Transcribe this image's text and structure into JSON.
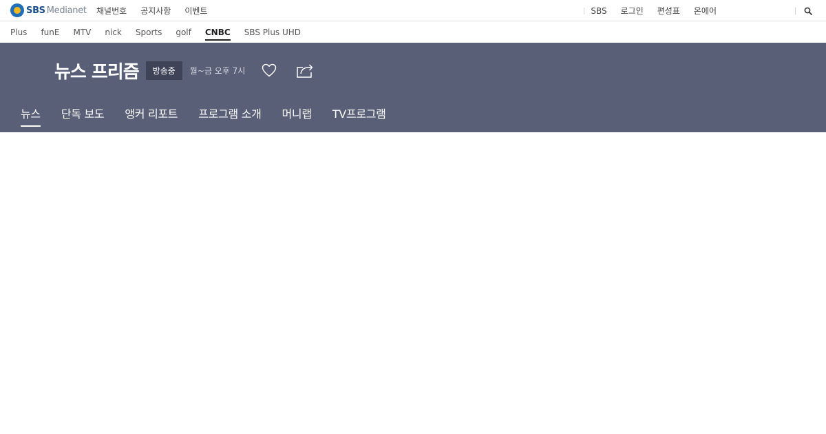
{
  "brand": {
    "logo_primary": "SBS",
    "logo_secondary": "Medianet",
    "logo_icon": "sbs-logo-icon",
    "accent_color": "#1e6fb8"
  },
  "topnav": {
    "left": [
      "채널번호",
      "공지사항",
      "이벤트"
    ],
    "right": [
      "SBS",
      "로그인",
      "편성표",
      "온에어"
    ],
    "search_icon": "search-icon"
  },
  "channels": {
    "items": [
      "Plus",
      "funE",
      "MTV",
      "nick",
      "Sports",
      "golf",
      "CNBC",
      "SBS Plus UHD"
    ],
    "active": "CNBC"
  },
  "program": {
    "title": "뉴스 프리즘",
    "status_badge": "방송중",
    "schedule": "월~금 오후 7시",
    "favorite_icon": "heart-icon",
    "share_icon": "share-icon",
    "header_color": "#585f77",
    "tabs": [
      "뉴스",
      "단독 보도",
      "앵커 리포트",
      "프로그램 소개",
      "머니랩",
      "TV프로그램"
    ],
    "active_tab": "뉴스"
  }
}
